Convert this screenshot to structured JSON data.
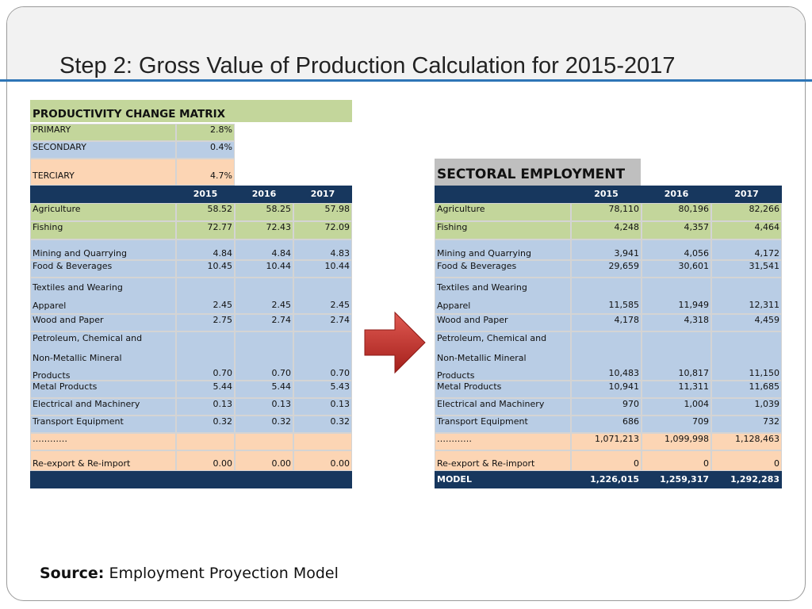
{
  "title": "Step 2: Gross Value of Production Calculation for 2015-2017",
  "source": {
    "label": "Source:",
    "text": "Employment Proyection Model"
  },
  "productivity": {
    "title": "PRODUCTIVITY CHANGE MATRIX",
    "sectors": [
      {
        "label": "PRIMARY",
        "value": "2.8%"
      },
      {
        "label": "SECONDARY",
        "value": "0.4%"
      },
      {
        "label": "TERCIARY",
        "value": "4.7%"
      }
    ],
    "years": [
      "2015",
      "2016",
      "2017"
    ],
    "rows": [
      {
        "label": "Agriculture",
        "v": [
          "58.52",
          "58.25",
          "57.98"
        ]
      },
      {
        "label": "Fishing",
        "v": [
          "72.77",
          "72.43",
          "72.09"
        ]
      },
      {
        "label": "Mining and Quarrying",
        "v": [
          "4.84",
          "4.84",
          "4.83"
        ]
      },
      {
        "label": "Food & Beverages",
        "v": [
          "10.45",
          "10.44",
          "10.44"
        ]
      },
      {
        "label1": "Textiles and Wearing",
        "label2": "Apparel",
        "v": [
          "2.45",
          "2.45",
          "2.45"
        ]
      },
      {
        "label": "Wood and Paper",
        "v": [
          "2.75",
          "2.74",
          "2.74"
        ]
      },
      {
        "label1": "Petroleum, Chemical and",
        "label2": "Non-Metallic Mineral",
        "label3": "Products",
        "v": [
          "0.70",
          "0.70",
          "0.70"
        ]
      },
      {
        "label": "Metal Products",
        "v": [
          "5.44",
          "5.44",
          "5.43"
        ]
      },
      {
        "label": "Electrical and Machinery",
        "v": [
          "0.13",
          "0.13",
          "0.13"
        ]
      },
      {
        "label": "Transport Equipment",
        "v": [
          "0.32",
          "0.32",
          "0.32"
        ]
      },
      {
        "label": "…………",
        "v": [
          "",
          "",
          ""
        ]
      },
      {
        "label": "Re-export & Re-import",
        "v": [
          "0.00",
          "0.00",
          "0.00"
        ]
      }
    ]
  },
  "employment": {
    "title": "SECTORAL EMPLOYMENT",
    "years": [
      "2015",
      "2016",
      "2017"
    ],
    "rows": [
      {
        "label": "Agriculture",
        "v": [
          "78,110",
          "80,196",
          "82,266"
        ]
      },
      {
        "label": "Fishing",
        "v": [
          "4,248",
          "4,357",
          "4,464"
        ]
      },
      {
        "label": "Mining and Quarrying",
        "v": [
          "3,941",
          "4,056",
          "4,172"
        ]
      },
      {
        "label": "Food & Beverages",
        "v": [
          "29,659",
          "30,601",
          "31,541"
        ]
      },
      {
        "label1": "Textiles and Wearing",
        "label2": "Apparel",
        "v": [
          "11,585",
          "11,949",
          "12,311"
        ]
      },
      {
        "label": "Wood and Paper",
        "v": [
          "4,178",
          "4,318",
          "4,459"
        ]
      },
      {
        "label1": "Petroleum, Chemical and",
        "label2": "Non-Metallic Mineral",
        "label3": "Products",
        "v": [
          "10,483",
          "10,817",
          "11,150"
        ]
      },
      {
        "label": "Metal Products",
        "v": [
          "10,941",
          "11,311",
          "11,685"
        ]
      },
      {
        "label": "Electrical and Machinery",
        "v": [
          "970",
          "1,004",
          "1,039"
        ]
      },
      {
        "label": "Transport Equipment",
        "v": [
          "686",
          "709",
          "732"
        ]
      },
      {
        "label": "…………",
        "v": [
          "1,071,213",
          "1,099,998",
          "1,128,463"
        ]
      },
      {
        "label": "Re-export & Re-import",
        "v": [
          "0",
          "0",
          "0"
        ]
      },
      {
        "label": "MODEL",
        "v": [
          "1,226,015",
          "1,259,317",
          "1,292,283"
        ]
      }
    ]
  },
  "colors": {
    "header": "#17375e",
    "primary": "#c3d69b",
    "secondary": "#b9cde5",
    "terciary": "#fcd5b4",
    "arrow": "#c0312b",
    "rule": "#2e75b6"
  },
  "icons": {
    "arrow": "right-arrow-icon"
  }
}
